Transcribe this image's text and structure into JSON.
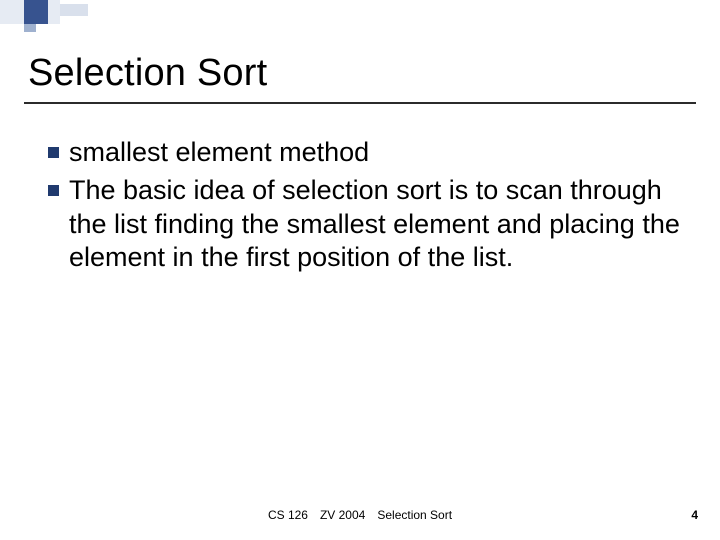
{
  "slide": {
    "title": "Selection Sort",
    "bullets": [
      "smallest element method",
      "The basic idea of selection sort is to scan through the list finding the smallest element and placing the element in the first position of the list."
    ]
  },
  "footer": {
    "course": "CS 126",
    "author_year": "ZV 2004",
    "topic": "Selection Sort"
  },
  "page_number": "4"
}
